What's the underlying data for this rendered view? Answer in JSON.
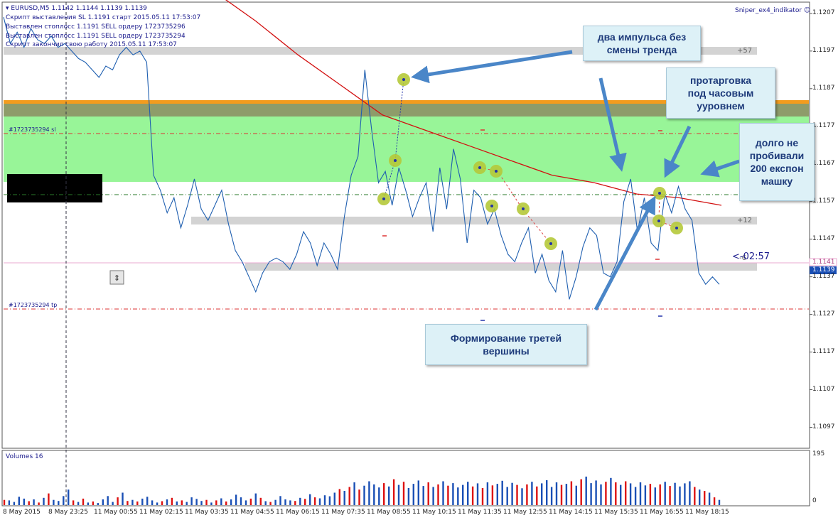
{
  "header": {
    "symbol_line": "EURUSD,M5  1.1142 1.1144 1.1139 1.1139",
    "lines": [
      "Скрипт выставления SL 1.1191 старт 2015.05.11 17:53:07",
      "Выставлен стоплосс 1.1191 SELL ордеру 1723735296",
      "Выставлен стоплосс 1.1191 SELL ордеру 1723735294",
      "Скрипт закончил свою работу 2015.05.11 17:53:07"
    ]
  },
  "indicator_name": "Sniper_ex4_indikator",
  "price_axis": [
    "1.1207",
    "1.1197",
    "1.1187",
    "1.1177",
    "1.1167",
    "1.1157",
    "1.1147",
    "1.1137",
    "1.1127",
    "1.1117",
    "1.1107",
    "1.1097"
  ],
  "current_price": "1.1139",
  "bid_marker": "1.1141",
  "timer": "<-02:57",
  "order_labels": {
    "sl": "#1723735294 sl",
    "tp": "#1723735294 tp"
  },
  "band_labels": {
    "top": "+57",
    "mid": "+12",
    "low": "-6"
  },
  "volume_panel": {
    "title": "Volumes 16",
    "max_label": "195",
    "min_label": "0"
  },
  "time_axis": [
    "8 May 2015",
    "8 May 23:25",
    "11 May 00:55",
    "11 May 02:15",
    "11 May 03:35",
    "11 May 04:55",
    "11 May 06:15",
    "11 May 07:35",
    "11 May 08:55",
    "11 May 10:15",
    "11 May 11:35",
    "11 May 12:55",
    "11 May 14:15",
    "11 May 15:35",
    "11 May 16:55",
    "11 May 18:15"
  ],
  "callouts": {
    "two_impulses": "два импульса без\nсмены тренда",
    "consolidation": "протарговка\nпод часовым\nууровнем",
    "ema200": "долго не\nпробивали\n200 експон\nмашку",
    "third_top": "Формирование третей\nвершины"
  },
  "colors": {
    "price_line": "#1f5fb0",
    "ema": "#d21010",
    "green_zone": "#98f598",
    "orange_zone": "#f39c1e",
    "gray_band": "#d3d3d3",
    "arrow": "#4a86c8",
    "vol_up": "#1a4fb5",
    "vol_down": "#dd1111"
  },
  "chart_data": {
    "type": "line",
    "series": [
      {
        "values": [
          1.1206,
          1.1199,
          1.1202,
          1.1198,
          1.1203,
          1.12,
          1.1199,
          1.1201,
          1.1198,
          1.1199,
          1.1197,
          1.1195,
          1.1194,
          1.1192,
          1.119,
          1.1193,
          1.1192,
          1.1196,
          1.1198,
          1.1196,
          1.1197,
          1.1194,
          1.1164,
          1.116,
          1.1154,
          1.1158,
          1.115,
          1.1156,
          1.1163,
          1.1155,
          1.1152,
          1.1156,
          1.116,
          1.1151,
          1.1144,
          1.1141,
          1.1137,
          1.1133,
          1.1138,
          1.1141,
          1.1142,
          1.1141,
          1.1139,
          1.1143,
          1.1149,
          1.1146,
          1.114,
          1.1146,
          1.1143,
          1.1139,
          1.1153,
          1.1164,
          1.1169,
          1.1192,
          1.1176,
          1.1162,
          1.1165,
          1.1156,
          1.1166,
          1.116,
          1.1153,
          1.1158,
          1.1162,
          1.1149,
          1.1166,
          1.1155,
          1.1171,
          1.1163,
          1.1146,
          1.116,
          1.1158,
          1.1151,
          1.1155,
          1.1148,
          1.1143,
          1.1141,
          1.1146,
          1.115,
          1.1138,
          1.1143,
          1.1136,
          1.1133,
          1.1144,
          1.1131,
          1.1137,
          1.1145,
          1.115,
          1.1148,
          1.1138,
          1.1137,
          1.1141,
          1.1157,
          1.1163,
          1.1149,
          1.1158,
          1.1146,
          1.1144,
          1.1159,
          1.1154,
          1.1161,
          1.1155,
          1.1152,
          1.1138,
          1.1135,
          1.1137,
          1.1135
        ]
      },
      {
        "name": "EMA 200",
        "values": [
          1.1213,
          1.1205,
          1.1196,
          1.1188,
          1.118,
          1.1176,
          1.1172,
          1.1168,
          1.1164,
          1.1162,
          1.1159,
          1.1158,
          1.1156
        ]
      }
    ],
    "ylim": [
      1.1092,
      1.121
    ]
  },
  "volume_data": [
    20,
    18,
    12,
    32,
    25,
    15,
    22,
    10,
    28,
    45,
    20,
    16,
    35,
    60,
    18,
    12,
    25,
    10,
    14,
    8,
    22,
    35,
    12,
    30,
    48,
    16,
    20,
    14,
    25,
    32,
    18,
    10,
    15,
    22,
    28,
    14,
    18,
    12,
    30,
    24,
    16,
    20,
    10,
    18,
    26,
    14,
    22,
    40,
    30,
    18,
    25,
    45,
    28,
    15,
    12,
    20,
    35,
    22,
    18,
    16,
    28,
    24,
    42,
    30,
    26,
    38,
    34,
    48,
    62,
    55,
    70,
    88,
    60,
    75,
    92,
    80,
    68,
    85,
    72,
    100,
    78,
    90,
    66,
    82,
    95,
    74,
    88,
    70,
    80,
    92,
    75,
    85,
    68,
    78,
    90,
    72,
    84,
    66,
    88,
    76,
    82,
    94,
    70,
    86,
    78,
    65,
    80,
    90,
    72,
    84,
    96,
    70,
    88,
    78,
    82,
    92,
    75,
    100,
    110,
    85,
    95,
    80,
    90,
    105,
    88,
    78,
    92,
    84,
    70,
    88,
    76,
    82,
    68,
    80,
    90,
    74,
    86,
    72,
    84,
    92,
    70,
    60,
    55,
    48,
    30,
    20
  ]
}
